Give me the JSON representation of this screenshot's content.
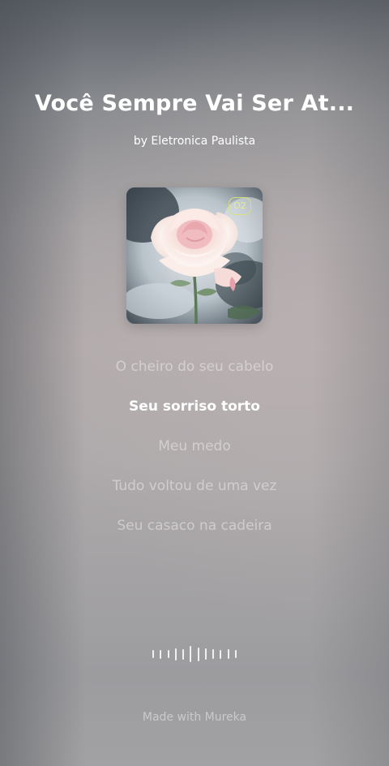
{
  "song": {
    "title": "Você Sempre Vai Ser At...",
    "artist": "by Eletronica Paulista"
  },
  "cover": {
    "badge": "O2",
    "badge_color": "#d8e07a",
    "art": "rose-watercolor"
  },
  "lyrics": [
    "O cheiro do seu cabelo",
    "Seu sorriso torto",
    "Meu medo",
    "Tudo voltou de uma vez",
    "Seu casaco na cadeira"
  ],
  "active_lyric_index": 1,
  "visualizer": {
    "icon": "audio-wave-icon",
    "levels": [
      0.35,
      0.45,
      0.4,
      0.7,
      0.55,
      1.0,
      0.8,
      0.6,
      0.5,
      0.45,
      0.5,
      0.4
    ]
  },
  "footer": {
    "credit": "Made with Mureka"
  }
}
